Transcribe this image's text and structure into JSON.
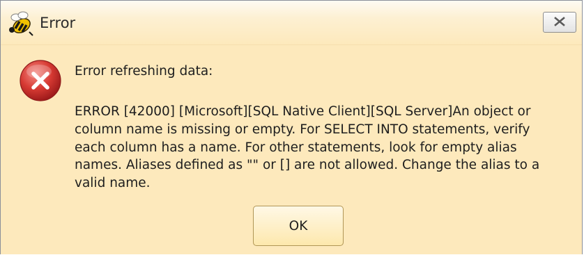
{
  "window": {
    "title": "Error",
    "app_icon": "bee-icon",
    "close_icon": "close-icon"
  },
  "body": {
    "status_icon": "error-icon",
    "heading": "Error refreshing data:",
    "message_lines": [
      "ERROR [42000] [Microsoft][SQL Native Client][SQL Server]An object or",
      "column name is missing or empty. For SELECT INTO statements, verify",
      "each column has a name. For other statements, look for empty alias",
      "names. Aliases defined as \"\" or [] are not allowed. Change the alias to a",
      "valid name."
    ]
  },
  "buttons": {
    "ok_label": "OK"
  },
  "colors": {
    "dialog_background": "#fde9bc",
    "error_red": "#c62a2a",
    "button_border": "#b09656"
  }
}
